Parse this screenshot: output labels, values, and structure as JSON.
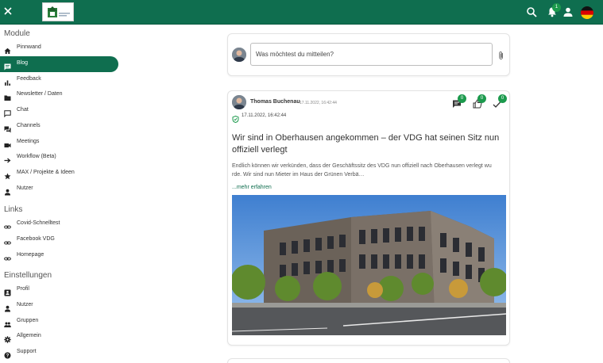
{
  "header": {
    "badges": {
      "notifications": "1",
      "comments": "0",
      "likes": "0",
      "done": "0"
    }
  },
  "sidebar": {
    "module_title": "Module",
    "module_items": [
      {
        "label": "Pinnwand"
      },
      {
        "label": "Blog"
      },
      {
        "label": "Feedback"
      },
      {
        "label": "Newsletter / Daten"
      },
      {
        "label": "Chat"
      },
      {
        "label": "Channels"
      },
      {
        "label": "Meetings"
      },
      {
        "label": "Workflow (Beta)"
      },
      {
        "label": "MAX / Projekte & Ideen"
      },
      {
        "label": "Nutzer"
      }
    ],
    "links_title": "Links",
    "link_items": [
      {
        "label": "Covid-Schnelltest"
      },
      {
        "label": "Facebook VDG"
      },
      {
        "label": "Homepage"
      }
    ],
    "settings_title": "Einstellungen",
    "settings_items": [
      {
        "label": "Profil"
      },
      {
        "label": "Nutzer"
      },
      {
        "label": "Gruppen"
      },
      {
        "label": "Allgemein"
      },
      {
        "label": "Support"
      }
    ]
  },
  "composer": {
    "placeholder": "Was möchtest du mitteilen?"
  },
  "post": {
    "author": "Thomas Buchenau",
    "created": "17.11.2022, 16:42:44",
    "published": "17.11.2022, 16:42:44",
    "title": "Wir sind in Oberhausen angekommen – der VDG hat seinen Sitz nun offiziell verlegt",
    "excerpt_line1": "Endlich können wir verkünden, dass der Geschäftssitz des VDG nun offiziell nach Oberhausen verlegt wu",
    "excerpt_line2": "rde. Wir sind nun Mieter im Haus der Grünen Verbä…",
    "more": "...mehr erfahren"
  },
  "colors": {
    "brand": "#0f6e4f",
    "badge": "#1c9a4d"
  }
}
